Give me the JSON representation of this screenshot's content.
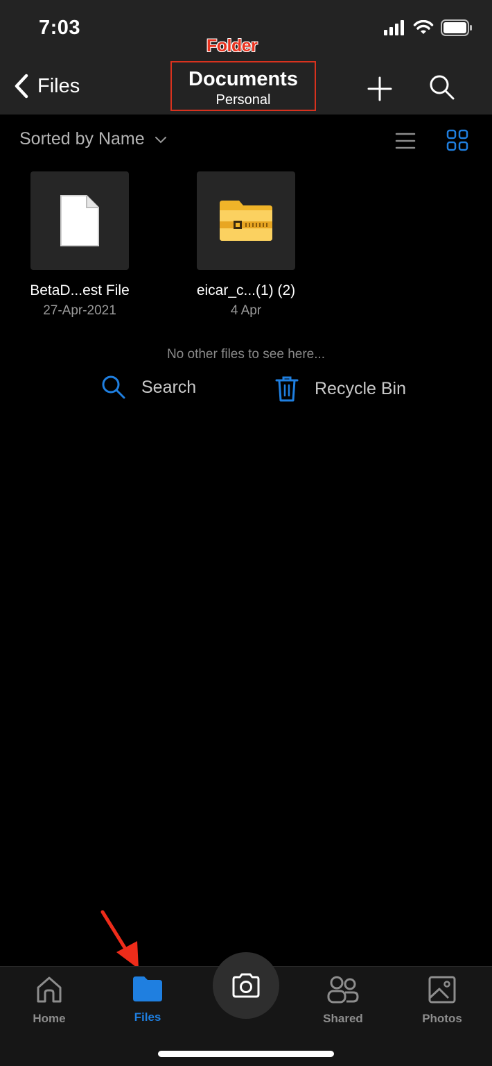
{
  "status": {
    "time": "7:03"
  },
  "annotation": {
    "label": "Folder"
  },
  "header": {
    "back_label": "Files",
    "title": "Documents",
    "subtitle": "Personal"
  },
  "sort": {
    "label": "Sorted by Name"
  },
  "files": [
    {
      "name": "BetaD...est File",
      "date": "27-Apr-2021",
      "icon": "document-icon"
    },
    {
      "name": "eicar_c...(1) (2)",
      "date": "4 Apr",
      "icon": "zip-folder-icon"
    }
  ],
  "empty_message": "No other files to see here...",
  "actions": {
    "search_label": "Search",
    "recycle_label": "Recycle Bin"
  },
  "tabs": [
    {
      "label": "Home",
      "icon": "home-icon",
      "active": false
    },
    {
      "label": "Files",
      "icon": "folder-icon",
      "active": true
    },
    {
      "label": "Shared",
      "icon": "people-icon",
      "active": false
    },
    {
      "label": "Photos",
      "icon": "photo-icon",
      "active": false
    }
  ],
  "colors": {
    "accent": "#1f7fe0",
    "annotation": "#d8321e",
    "header_bg": "#232323",
    "zip_folder": "#f5c242"
  }
}
